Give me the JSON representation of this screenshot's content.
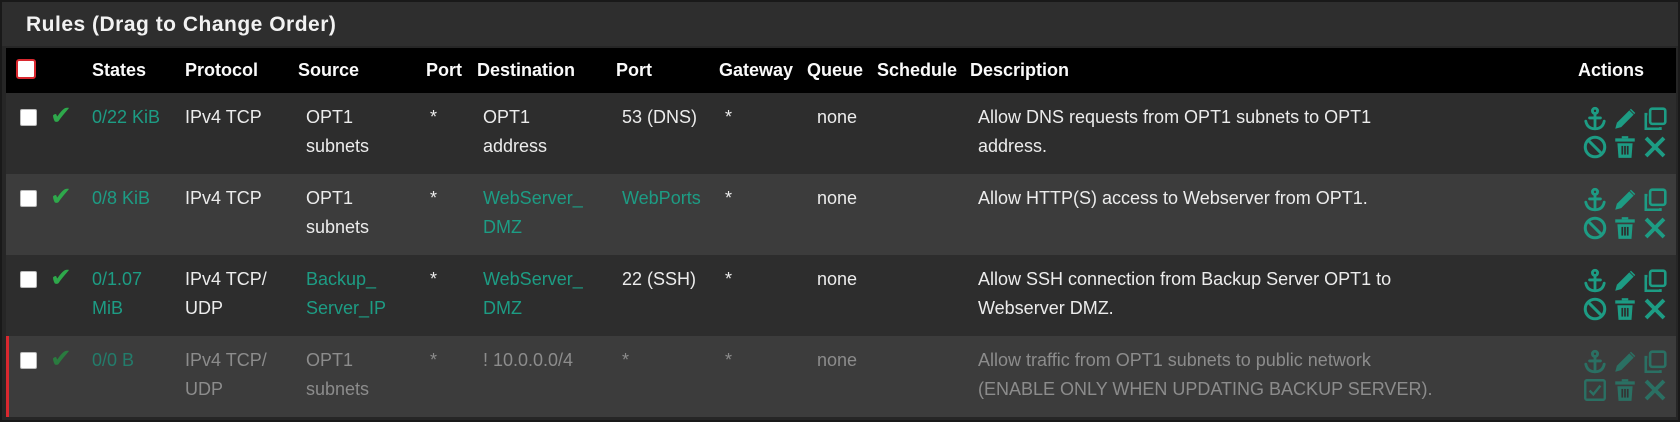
{
  "panel": {
    "title": "Rules (Drag to Change Order)"
  },
  "columns": {
    "states": "States",
    "protocol": "Protocol",
    "source": "Source",
    "port": "Port",
    "destination": "Destination",
    "dest_port": "Port",
    "gateway": "Gateway",
    "queue": "Queue",
    "schedule": "Schedule",
    "description": "Description",
    "actions": "Actions"
  },
  "rules": [
    {
      "states_1": "0/22 KiB",
      "states_2": "",
      "protocol_1": "IPv4 TCP",
      "protocol_2": "",
      "source_1": "OPT1",
      "source_2": "subnets",
      "port": "*",
      "dest_1": "OPT1",
      "dest_2": "address",
      "dest_port": "53 (DNS)",
      "gateway": "*",
      "queue": "none",
      "schedule": "",
      "desc_1": "Allow DNS requests from OPT1 subnets to OPT1",
      "desc_2": "address.",
      "enabled": true
    },
    {
      "states_1": "0/8 KiB",
      "states_2": "",
      "protocol_1": "IPv4 TCP",
      "protocol_2": "",
      "source_1": "OPT1",
      "source_2": "subnets",
      "port": "*",
      "dest_1": "WebServer_",
      "dest_2": "DMZ",
      "dest_port": "WebPorts",
      "gateway": "*",
      "queue": "none",
      "schedule": "",
      "desc_1": "Allow HTTP(S) access to Webserver from OPT1.",
      "desc_2": "",
      "enabled": true
    },
    {
      "states_1": "0/1.07",
      "states_2": "MiB",
      "protocol_1": "IPv4 TCP/",
      "protocol_2": "UDP",
      "source_1": "Backup_",
      "source_2": "Server_IP",
      "port": "*",
      "dest_1": "WebServer_",
      "dest_2": "DMZ",
      "dest_port": "22 (SSH)",
      "gateway": "*",
      "queue": "none",
      "schedule": "",
      "desc_1": "Allow SSH connection from Backup Server OPT1 to",
      "desc_2": "Webserver DMZ.",
      "enabled": true
    },
    {
      "states_1": "0/0 B",
      "states_2": "",
      "protocol_1": "IPv4 TCP/",
      "protocol_2": "UDP",
      "source_1": "OPT1",
      "source_2": "subnets",
      "port": "*",
      "dest_1": "! 10.0.0.0/4",
      "dest_2": "",
      "dest_port": "*",
      "gateway": "*",
      "queue": "none",
      "schedule": "",
      "desc_1": "Allow traffic from OPT1 subnets to public network",
      "desc_2": "(ENABLE ONLY WHEN UPDATING BACKUP SERVER).",
      "enabled": false
    }
  ],
  "icons": {
    "anchor": "anchor-icon",
    "edit": "pencil-icon",
    "copy": "copy-icon",
    "disable": "ban-icon",
    "enable": "checkbox-icon",
    "delete": "trash-icon",
    "remove": "close-icon"
  },
  "colors": {
    "accent": "#1d9c84",
    "pass": "#2ea84b",
    "disabled_marker": "#d9282f"
  }
}
